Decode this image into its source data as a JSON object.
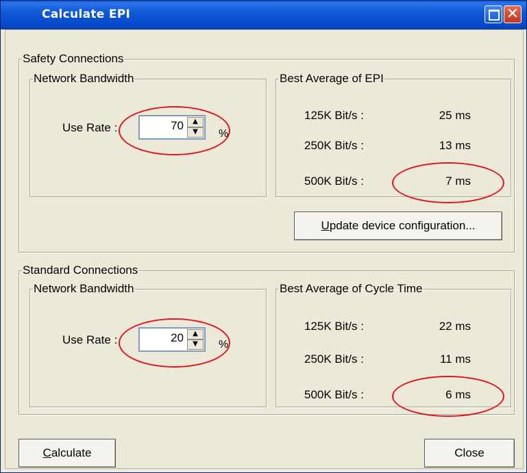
{
  "window": {
    "title": "Calculate EPI"
  },
  "safety": {
    "group_label": "Safety Connections",
    "bandwidth_label": "Network Bandwidth",
    "use_rate_label": "Use Rate :",
    "use_rate_value": "70",
    "percent": "%",
    "best_label": "Best Average of EPI",
    "rows": [
      {
        "rate": "125K Bit/s :",
        "value": "25 ms"
      },
      {
        "rate": "250K Bit/s :",
        "value": "13 ms"
      },
      {
        "rate": "500K Bit/s :",
        "value": "7 ms"
      }
    ],
    "update_button_mnemonic": "U",
    "update_button_rest": "pdate device configuration..."
  },
  "standard": {
    "group_label": "Standard Connections",
    "bandwidth_label": "Network Bandwidth",
    "use_rate_label": "Use Rate :",
    "use_rate_value": "20",
    "percent": "%",
    "best_label": "Best Average of Cycle Time",
    "rows": [
      {
        "rate": "125K Bit/s :",
        "value": "22 ms"
      },
      {
        "rate": "250K Bit/s :",
        "value": "11 ms"
      },
      {
        "rate": "500K Bit/s :",
        "value": "6 ms"
      }
    ]
  },
  "footer": {
    "calculate_mnemonic": "C",
    "calculate_rest": "alculate",
    "close_label": "Close"
  },
  "annotation_color": "#e0141e"
}
